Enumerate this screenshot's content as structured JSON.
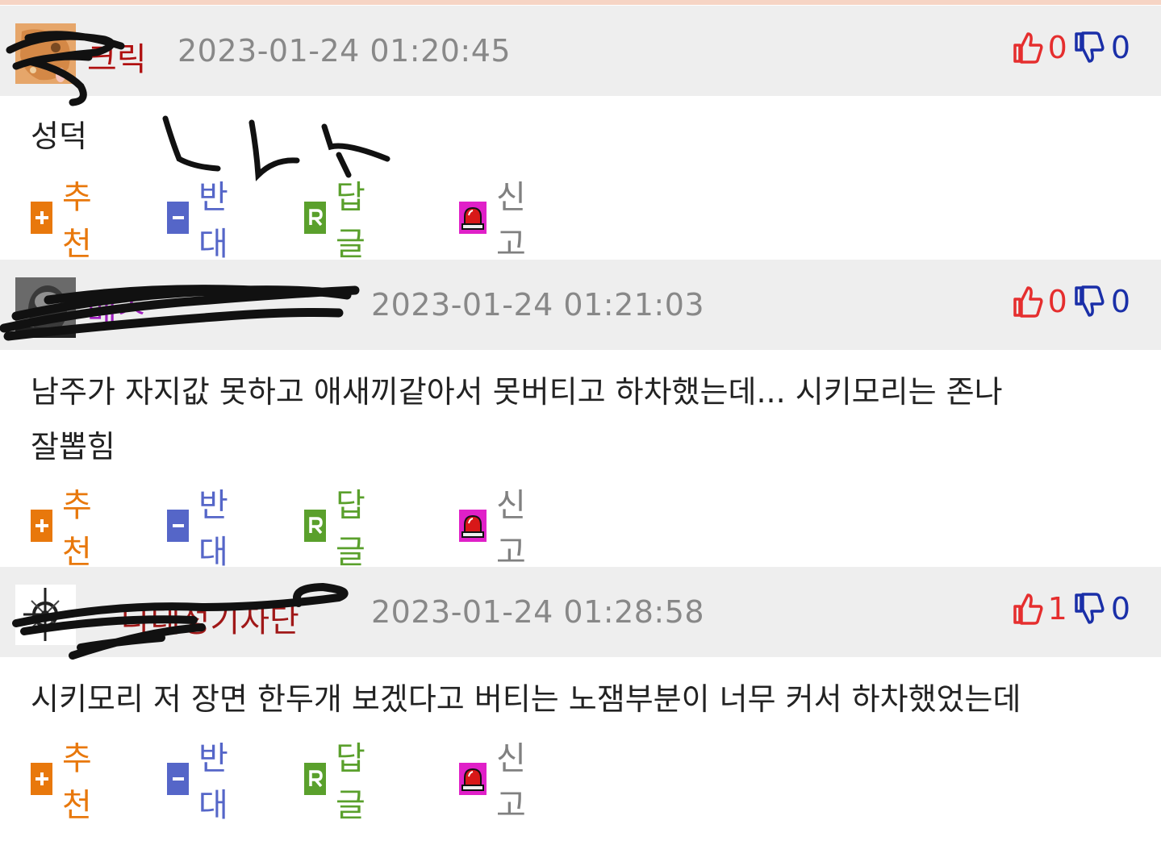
{
  "comments": [
    {
      "author": "크릭",
      "author_color": "#b01010",
      "timestamp": "2023-01-24 01:20:45",
      "up": "0",
      "down": "0",
      "body_lines": [
        "성덕"
      ]
    },
    {
      "author": "메스",
      "author_color": "#a020c0",
      "timestamp": "2023-01-24 01:21:03",
      "up": "0",
      "down": "0",
      "body_lines": [
        "남주가 자지값 못하고 애새끼같아서 못버티고 하차했는데... 시키모리는 존나",
        "잘뽑힘"
      ]
    },
    {
      "author": "다데성기자단",
      "author_color": "#a01818",
      "timestamp": "2023-01-24 01:28:58",
      "up": "1",
      "down": "0",
      "body_lines": [
        "시키모리 저 장면 한두개 보겠다고 버티는 노잼부분이 너무 커서 하차했었는데"
      ]
    }
  ],
  "actions": {
    "recommend": "추천",
    "oppose": "반대",
    "reply": "답글",
    "report": "신고",
    "recommend_color": "#e8780c",
    "oppose_color": "#5566c8",
    "reply_color": "#5aa02c",
    "report_color": "#808080"
  },
  "icons": {
    "recommend": "plus-icon",
    "oppose": "minus-icon",
    "reply": "reply-r-icon",
    "report": "siren-icon",
    "up": "thumbs-up-icon",
    "down": "thumbs-down-icon"
  }
}
